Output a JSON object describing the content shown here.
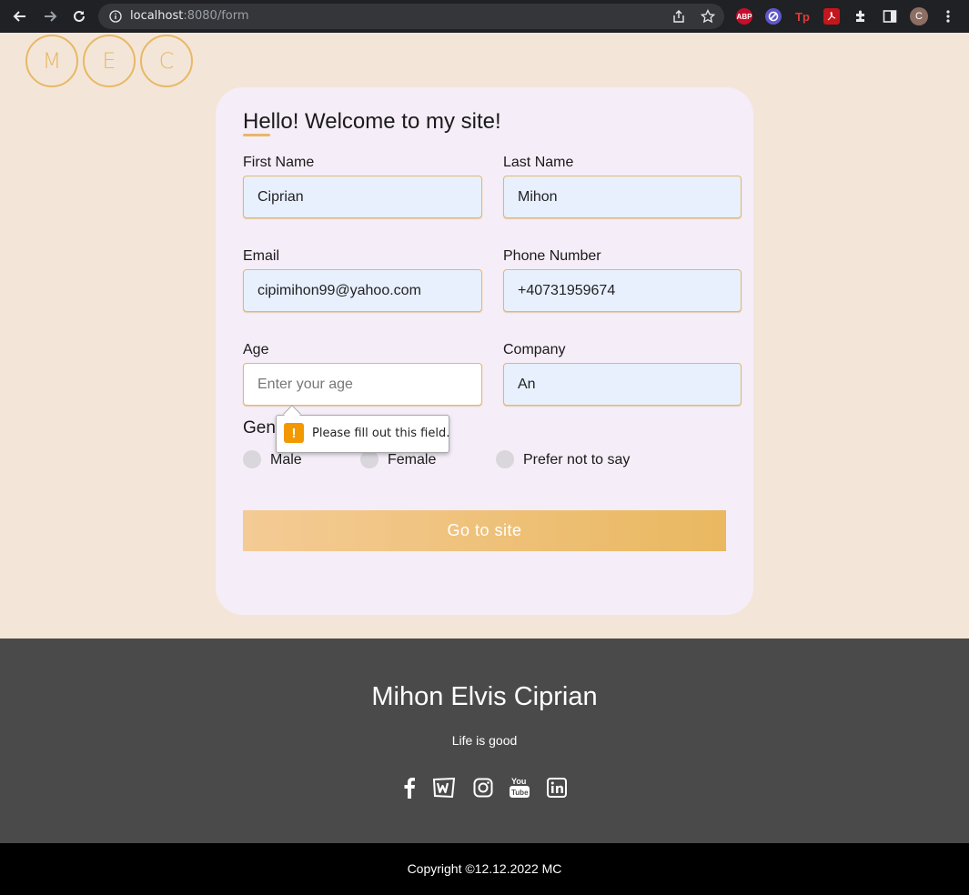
{
  "browser": {
    "url_host": "localhost",
    "url_path": ":8080/form",
    "profile_initial": "C",
    "extensions": [
      {
        "name": "adblock-plus-icon",
        "label": "ABP",
        "color": "#c70d2c"
      },
      {
        "name": "block-icon",
        "label": "",
        "color": "#5f57c9"
      },
      {
        "name": "tp-icon",
        "label": "Tp",
        "color": "#e53935"
      },
      {
        "name": "pdf-icon",
        "label": "",
        "color": "#c4161c"
      }
    ]
  },
  "logo": {
    "letters": [
      "M",
      "E",
      "C"
    ]
  },
  "form": {
    "title": "Hello! Welcome to my site!",
    "first_name": {
      "label": "First Name",
      "value": "Ciprian"
    },
    "last_name": {
      "label": "Last Name",
      "value": "Mihon"
    },
    "email": {
      "label": "Email",
      "value": "cipimihon99@yahoo.com"
    },
    "phone": {
      "label": "Phone Number",
      "value": "+40731959674"
    },
    "age": {
      "label": "Age",
      "value": "",
      "placeholder": "Enter your age"
    },
    "company": {
      "label": "Company",
      "value": "An"
    },
    "gender": {
      "label": "Gen",
      "options": [
        "Male",
        "Female",
        "Prefer not to say"
      ]
    },
    "submit_label": "Go to site",
    "validation_message": "Please fill out this field."
  },
  "footer": {
    "name": "Mihon Elvis Ciprian",
    "tagline": "Life is good",
    "social": [
      "facebook-icon",
      "webtoon-icon",
      "instagram-icon",
      "youtube-icon",
      "linkedin-icon"
    ],
    "copyright": "Copyright ©12.12.2022  MC"
  },
  "colors": {
    "accent": "#e7b867",
    "page_bg": "#f3e6d8",
    "card_bg": "#f5edf7",
    "footer_bg": "#4a4a4a"
  }
}
